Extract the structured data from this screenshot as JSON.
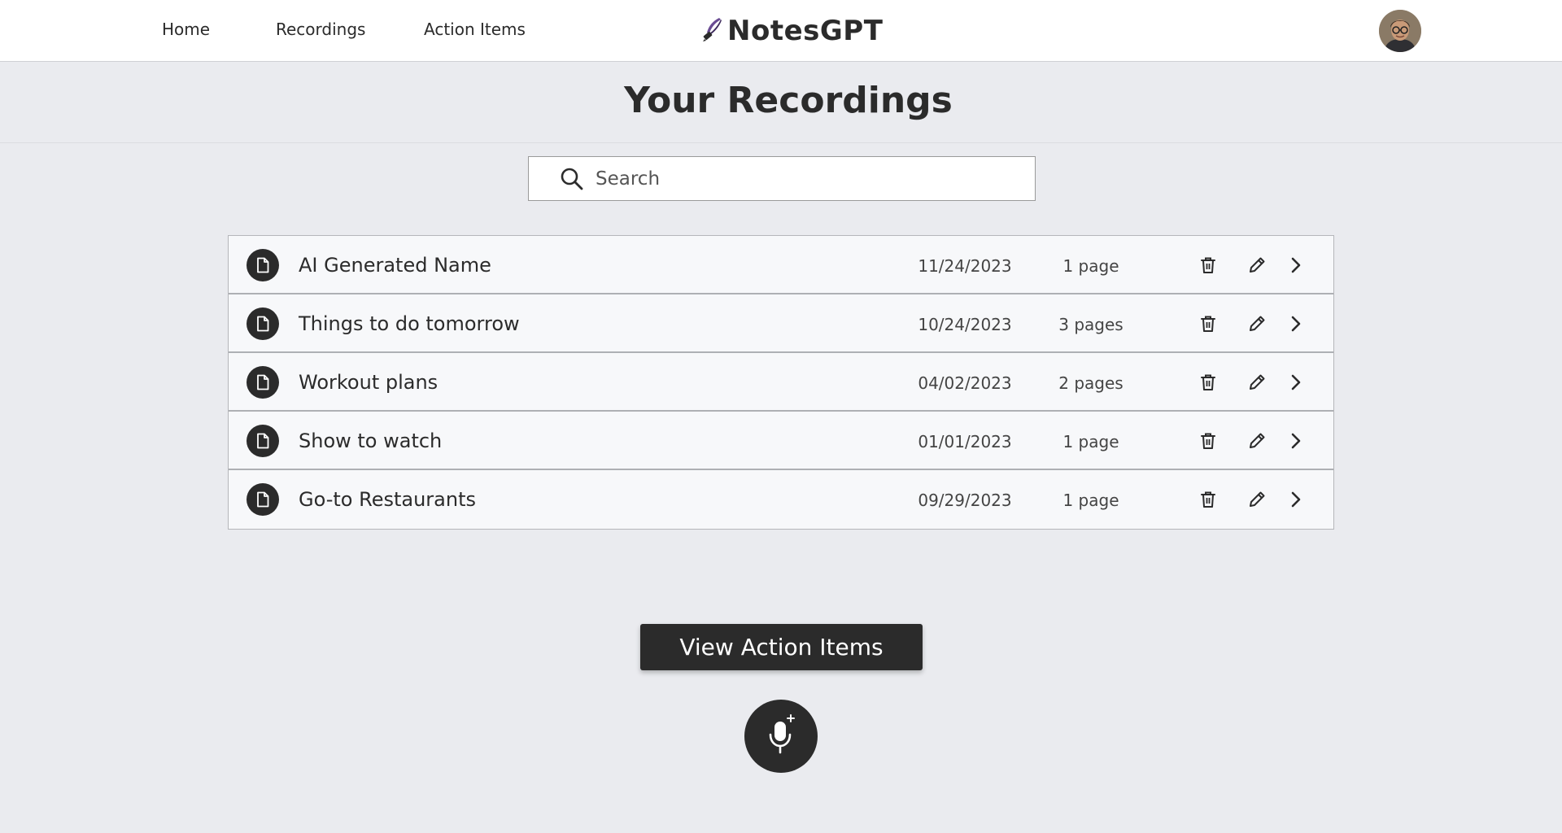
{
  "nav": {
    "links": [
      {
        "label": "Home"
      },
      {
        "label": "Recordings"
      },
      {
        "label": "Action Items"
      }
    ],
    "brand": "NotesGPT",
    "brand_icon": "feather-pen-icon"
  },
  "page": {
    "title": "Your Recordings"
  },
  "search": {
    "placeholder": "Search",
    "value": ""
  },
  "recordings": [
    {
      "name": "AI Generated Name",
      "date": "11/24/2023",
      "pages": "1 page"
    },
    {
      "name": "Things to do tomorrow",
      "date": "10/24/2023",
      "pages": "3 pages"
    },
    {
      "name": "Workout plans",
      "date": "04/02/2023",
      "pages": "2 pages"
    },
    {
      "name": "Show to watch",
      "date": "01/01/2023",
      "pages": "1 page"
    },
    {
      "name": "Go-to Restaurants",
      "date": "09/29/2023",
      "pages": "1 page"
    }
  ],
  "actions": {
    "view_action_items": "View Action Items",
    "record_icon": "microphone-plus-icon"
  },
  "colors": {
    "background": "#eaebef",
    "topbar": "#ffffff",
    "dark": "#2b2b2b",
    "brand_accent": "#6a4c93"
  }
}
